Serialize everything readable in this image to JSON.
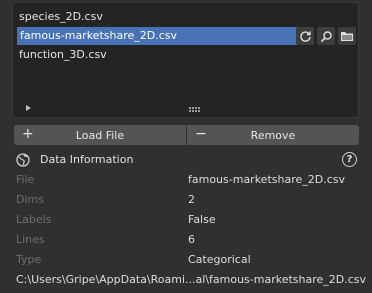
{
  "file_list": {
    "items": [
      {
        "label": "species_2D.csv",
        "selected": false
      },
      {
        "label": "famous-marketshare_2D.csv",
        "selected": true
      },
      {
        "label": "function_3D.csv",
        "selected": false
      }
    ]
  },
  "actions": {
    "load_label": "Load File",
    "load_symbol": "+",
    "remove_label": "Remove",
    "remove_symbol": "−"
  },
  "data_info": {
    "title": "Data Information",
    "help_glyph": "?",
    "rows": [
      {
        "label": "File",
        "value": "famous-marketshare_2D.csv"
      },
      {
        "label": "Dims",
        "value": "2"
      },
      {
        "label": "Labels",
        "value": "False"
      },
      {
        "label": "Lines",
        "value": "6"
      },
      {
        "label": "Type",
        "value": "Categorical"
      }
    ],
    "path": "C:\\Users\\Gripe\\AppData\\Roami...al\\famous-marketshare_2D.csv"
  },
  "colors": {
    "selection": "#4772b3",
    "button": "#545454",
    "background": "#303030",
    "list_background": "#242424"
  },
  "icons": [
    "refresh-icon",
    "search-icon",
    "folder-icon",
    "globe-icon",
    "help-icon"
  ]
}
